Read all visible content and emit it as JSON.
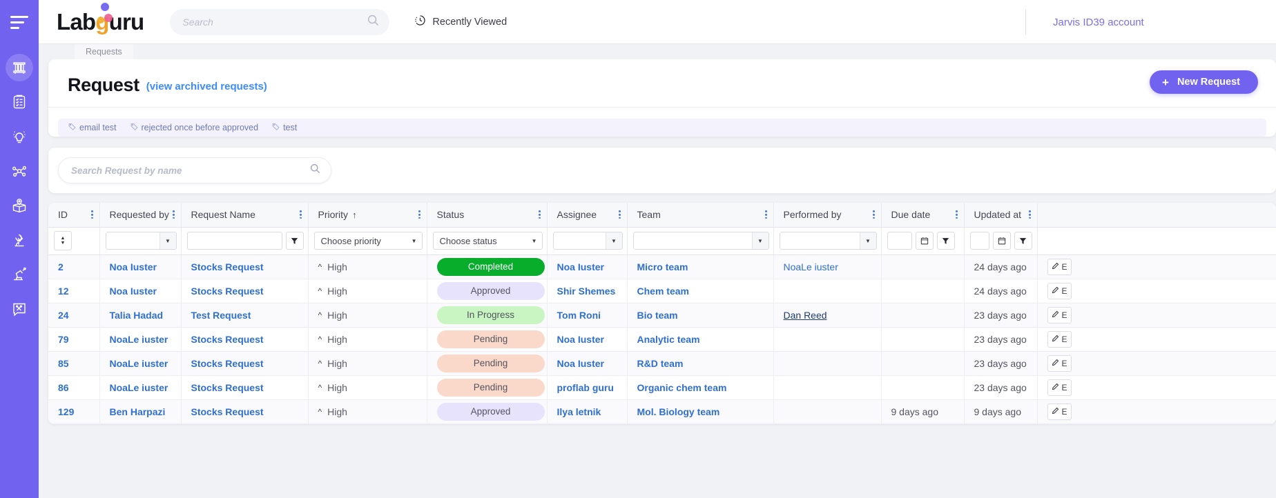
{
  "brand": {
    "name_part1": "Lab",
    "name_part2": "g",
    "name_part3": "uru"
  },
  "topbar": {
    "search_placeholder": "Search",
    "search_value": "",
    "recently_viewed": "Recently Viewed",
    "account": "Jarvis ID39 account"
  },
  "sidebar": {
    "items": [
      {
        "name": "tube-rack-icon",
        "label": "Inventory"
      },
      {
        "name": "clipboard-icon",
        "label": "Requests"
      },
      {
        "name": "lightbulb-icon",
        "label": "Ideas"
      },
      {
        "name": "molecule-icon",
        "label": "Compounds"
      },
      {
        "name": "box-location-icon",
        "label": "Storage"
      },
      {
        "name": "microscope-icon",
        "label": "Experiments"
      },
      {
        "name": "robot-arm-icon",
        "label": "Automation"
      },
      {
        "name": "tools-chat-icon",
        "label": "Support"
      }
    ]
  },
  "breadcrumb": {
    "label": "Requests"
  },
  "header": {
    "title": "Request",
    "archived_link": "(view archived requests)",
    "new_button": "New Request",
    "plus": "+"
  },
  "tags": [
    "email test",
    "rejected once before approved",
    "test"
  ],
  "search": {
    "placeholder": "Search Request by name",
    "value": ""
  },
  "table": {
    "columns": [
      {
        "label": "ID",
        "sorted": false
      },
      {
        "label": "Requested by",
        "sorted": false
      },
      {
        "label": "Request Name",
        "sorted": false
      },
      {
        "label": "Priority",
        "sorted": true,
        "sort_dir": "↑"
      },
      {
        "label": "Status",
        "sorted": false
      },
      {
        "label": "Assignee",
        "sorted": false
      },
      {
        "label": "Team",
        "sorted": false
      },
      {
        "label": "Performed by",
        "sorted": false
      },
      {
        "label": "Due date",
        "sorted": false
      },
      {
        "label": "Updated at",
        "sorted": false
      },
      {
        "label": "",
        "sorted": false
      }
    ],
    "filters": {
      "priority_placeholder": "Choose priority",
      "status_placeholder": "Choose status",
      "requested_by_value": "",
      "request_name_value": "",
      "assignee_value": "",
      "team_value": "",
      "performed_by_value": "",
      "due_date_value": "",
      "updated_at_value": ""
    },
    "rows": [
      {
        "id": "2",
        "requested_by": "Noa Iuster",
        "request_name": "Stocks Request",
        "priority": "High",
        "status": "Completed",
        "status_class": "completed",
        "assignee": "Noa Iuster",
        "team": "Micro team",
        "performed_by": "NoaLe iuster",
        "performed_by_style": "link",
        "due_date": "",
        "updated_at": "24 days ago",
        "edit_label": "E"
      },
      {
        "id": "12",
        "requested_by": "Noa Iuster",
        "request_name": "Stocks Request",
        "priority": "High",
        "status": "Approved",
        "status_class": "approved",
        "assignee": "Shir Shemes",
        "team": "Chem team",
        "performed_by": "",
        "performed_by_style": "link",
        "due_date": "",
        "updated_at": "24 days ago",
        "edit_label": "E"
      },
      {
        "id": "24",
        "requested_by": "Talia Hadad",
        "request_name": "Test Request",
        "priority": "High",
        "status": "In Progress",
        "status_class": "inprogress",
        "assignee": "Tom Roni",
        "team": "Bio team",
        "performed_by": "Dan Reed",
        "performed_by_style": "underline",
        "due_date": "",
        "updated_at": "23 days ago",
        "edit_label": "E"
      },
      {
        "id": "79",
        "requested_by": "NoaLe iuster",
        "request_name": "Stocks Request",
        "priority": "High",
        "status": "Pending",
        "status_class": "pending",
        "assignee": "Noa Iuster",
        "team": "Analytic team",
        "performed_by": "",
        "performed_by_style": "link",
        "due_date": "",
        "updated_at": "23 days ago",
        "edit_label": "E"
      },
      {
        "id": "85",
        "requested_by": "NoaLe iuster",
        "request_name": "Stocks Request",
        "priority": "High",
        "status": "Pending",
        "status_class": "pending",
        "assignee": "Noa Iuster",
        "team": "R&D team",
        "performed_by": "",
        "performed_by_style": "link",
        "due_date": "",
        "updated_at": "23 days ago",
        "edit_label": "E"
      },
      {
        "id": "86",
        "requested_by": "NoaLe iuster",
        "request_name": "Stocks Request",
        "priority": "High",
        "status": "Pending",
        "status_class": "pending",
        "assignee": "proflab guru",
        "team": "Organic chem team",
        "performed_by": "",
        "performed_by_style": "link",
        "due_date": "",
        "updated_at": "23 days ago",
        "edit_label": "E"
      },
      {
        "id": "129",
        "requested_by": "Ben Harpazi",
        "request_name": "Stocks Request",
        "priority": "High",
        "status": "Approved",
        "status_class": "approved",
        "assignee": "Ilya letnik",
        "team": "Mol. Biology team",
        "performed_by": "",
        "performed_by_style": "link",
        "due_date": "9 days ago",
        "updated_at": "9 days ago",
        "edit_label": "E"
      }
    ]
  },
  "colors": {
    "brand_purple": "#7162ef",
    "link_blue": "#2f6fd0",
    "status_completed": "#07ad2b",
    "status_approved": "#e8e3fd",
    "status_inprogress": "#c9f5c2",
    "status_pending": "#fbd9ca"
  }
}
